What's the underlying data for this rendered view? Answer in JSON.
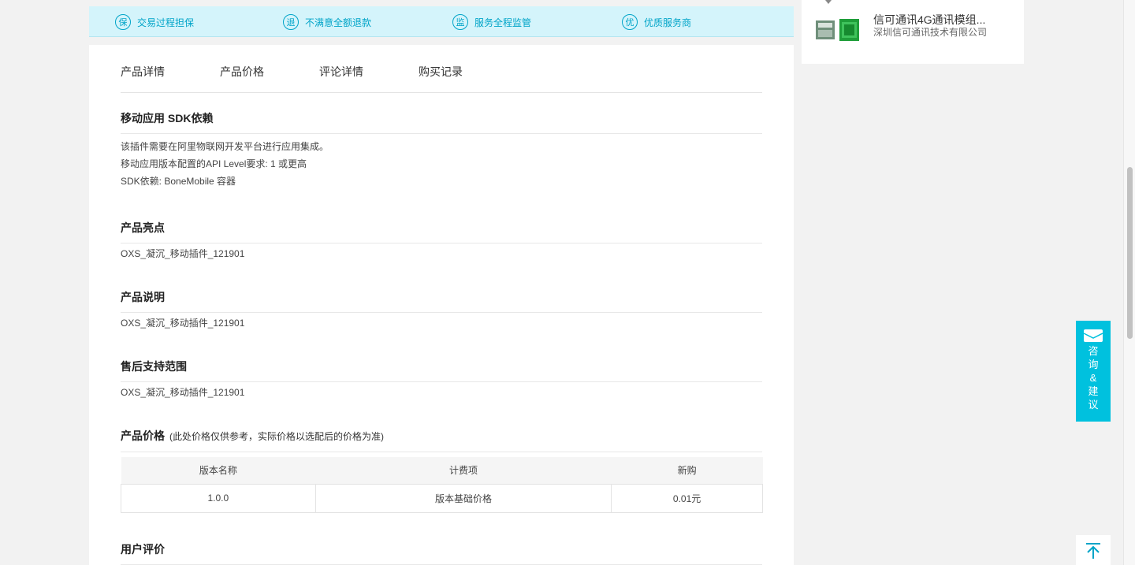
{
  "guarantees": [
    {
      "icon": "保",
      "label": "交易过程担保"
    },
    {
      "icon": "退",
      "label": "不满意全额退款"
    },
    {
      "icon": "监",
      "label": "服务全程监管"
    },
    {
      "icon": "优",
      "label": "优质服务商"
    }
  ],
  "tabs": [
    "产品详情",
    "产品价格",
    "评论详情",
    "购买记录"
  ],
  "sdk": {
    "title": "移动应用 SDK依赖",
    "lines": [
      "该插件需要在阿里物联网开发平台进行应用集成。",
      "移动应用版本配置的API Level要求:   1 或更高",
      "SDK依赖:  BoneMobile 容器"
    ]
  },
  "highlights": {
    "title": "产品亮点",
    "text": "OXS_凝沉_移动插件_121901"
  },
  "description": {
    "title": "产品说明",
    "text": "OXS_凝沉_移动插件_121901"
  },
  "after_sales": {
    "title": "售后支持范围",
    "text": "OXS_凝沉_移动插件_121901"
  },
  "price": {
    "title": "产品价格",
    "note": "(此处价格仅供参考，实际价格以选配后的价格为准)",
    "headers": [
      "版本名称",
      "计费项",
      "新购"
    ],
    "rows": [
      [
        "1.0.0",
        "版本基础价格",
        "0.01元"
      ]
    ]
  },
  "reviews": {
    "title": "用户评价"
  },
  "side_product": {
    "name": "信可通讯4G通讯模组...",
    "company": "深圳信可通讯技术有限公司"
  },
  "consult": {
    "label": "咨询&建议"
  },
  "colors": {
    "accent": "#00c1de",
    "guarantee_bg": "#d4f4fb",
    "guarantee_text": "#00a4c8"
  }
}
